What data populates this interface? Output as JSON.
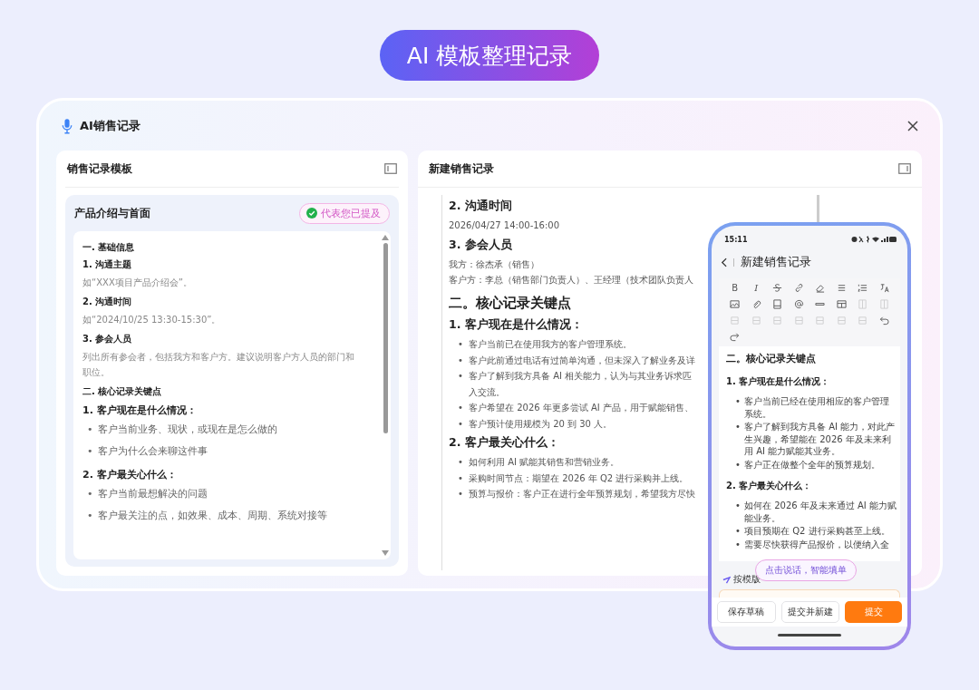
{
  "banner": {
    "title": "AI 模板整理记录"
  },
  "window": {
    "title": "AI销售记录"
  },
  "template_panel": {
    "title": "销售记录模板",
    "card": {
      "title": "产品介绍与首面",
      "badge": "代表您已提及",
      "blocks": [
        {
          "kind": "h3",
          "text": "一. 基础信息"
        },
        {
          "kind": "h3",
          "text": "1. 沟通主题"
        },
        {
          "kind": "hint",
          "lines": [
            "如“XXX项目产品介绍会”。"
          ]
        },
        {
          "kind": "h3",
          "text": "2. 沟通时间"
        },
        {
          "kind": "hint",
          "lines": [
            "如“2024/10/25 13:30-15:30”。"
          ]
        },
        {
          "kind": "h3",
          "text": "3. 参会人员"
        },
        {
          "kind": "hint",
          "lines": [
            "列出所有参会者，包括我方和客户方。建议说明客户方人员的部门和",
            "职位。"
          ]
        },
        {
          "kind": "h3",
          "text": "二. 核心记录关键点"
        },
        {
          "kind": "h2",
          "text": "1. 客户现在是什么情况："
        },
        {
          "kind": "bullets",
          "marker": "•",
          "items": [
            [
              "客户当前业务、现状，或现在是怎么做的"
            ],
            [
              "客户为什么会来聊这件事"
            ]
          ]
        },
        {
          "kind": "h2",
          "text": "2. 客户最关心什么："
        },
        {
          "kind": "bullets",
          "marker": "•",
          "items": [
            [
              "客户当前最想解决的问题"
            ],
            [
              "客户最关注的点，如效果、成本、周期、系统对接等"
            ]
          ]
        }
      ]
    }
  },
  "record_panel": {
    "title": "新建销售记录",
    "blocks": [
      {
        "kind": "h2",
        "text": "2. 沟通时间"
      },
      {
        "kind": "text",
        "lines": [
          "2026/04/27 14:00-16:00"
        ]
      },
      {
        "kind": "h2",
        "text": "3. 参会人员"
      },
      {
        "kind": "text",
        "lines": [
          "我方：徐杰承（销售）",
          "客户方：李总（销售部门负责人）、王经理（技术团队负责人"
        ]
      },
      {
        "kind": "h1",
        "text": "二。核心记录关键点"
      },
      {
        "kind": "h2",
        "text": "1. 客户现在是什么情况："
      },
      {
        "kind": "bullets",
        "marker": "•",
        "items": [
          [
            "客户当前已在使用我方的客户管理系统。"
          ],
          [
            "客户此前通过电话有过简单沟通，但未深入了解业务及详"
          ],
          [
            "客户了解到我方具备 AI 相关能力，认为与其业务诉求匹",
            "入交流。"
          ],
          [
            "客户希望在 2026 年更多尝试 AI 产品，用于赋能销售、"
          ],
          [
            "客户预计使用规模为 20 到 30 人。"
          ]
        ]
      },
      {
        "kind": "h2",
        "text": "2. 客户最关心什么："
      },
      {
        "kind": "bullets",
        "marker": "•",
        "items": [
          [
            "如何利用 AI 赋能其销售和营销业务。"
          ],
          [
            "采购时间节点：期望在 2026 年 Q2 进行采购并上线。"
          ],
          [
            "预算与报价：客户正在进行全年预算规划，希望我方尽快"
          ]
        ]
      }
    ]
  },
  "phone": {
    "time": "15:11",
    "title": "新建销售记录",
    "toolbar": [
      {
        "kind": "bold",
        "label": "B",
        "disabled": false
      },
      {
        "kind": "italic",
        "label": "I",
        "disabled": false
      },
      {
        "kind": "strike",
        "disabled": false
      },
      {
        "kind": "link",
        "disabled": false
      },
      {
        "kind": "eraser",
        "disabled": false
      },
      {
        "kind": "bullets",
        "disabled": false
      },
      {
        "kind": "numbers",
        "disabled": false
      },
      {
        "kind": "translate",
        "disabled": false
      },
      {
        "kind": "image",
        "disabled": false
      },
      {
        "kind": "clip",
        "disabled": false
      },
      {
        "kind": "card",
        "disabled": false
      },
      {
        "kind": "at",
        "disabled": false
      },
      {
        "kind": "tag",
        "disabled": false
      },
      {
        "kind": "table",
        "disabled": false
      },
      {
        "kind": "column",
        "disabled": true
      },
      {
        "kind": "column",
        "disabled": true
      },
      {
        "kind": "block",
        "disabled": true
      },
      {
        "kind": "block",
        "disabled": true
      },
      {
        "kind": "block",
        "disabled": true
      },
      {
        "kind": "block",
        "disabled": true
      },
      {
        "kind": "block",
        "disabled": true
      },
      {
        "kind": "block",
        "disabled": true
      },
      {
        "kind": "block",
        "disabled": true
      },
      {
        "kind": "undo",
        "disabled": false
      },
      {
        "kind": "redo",
        "disabled": false
      }
    ],
    "blocks": [
      {
        "kind": "h1",
        "text": "二。核心记录关键点"
      },
      {
        "kind": "h2",
        "text": "1. 客户现在是什么情况："
      },
      {
        "kind": "bullets",
        "marker": "•",
        "items": [
          [
            "客户当前已经在使用相应的客户管理",
            "系统。"
          ],
          [
            "客户了解到我方具备 AI 能力，对此产",
            "生兴趣，希望能在 2026 年及未来利",
            "用 AI 能力赋能其业务。"
          ],
          [
            "客户正在做整个全年的预算规划。"
          ]
        ]
      },
      {
        "kind": "h2",
        "text": "2. 客户最关心什么："
      },
      {
        "kind": "bullets",
        "marker": "•",
        "items": [
          [
            "如何在 2026 年及未来通过 AI 能力赋",
            "能业务。"
          ],
          [
            "项目预期在 Q2 进行采购甚至上线。"
          ],
          [
            "需要尽快获得产品报价，以便纳入全"
          ]
        ]
      }
    ],
    "template_hint": "按模版",
    "voice_button": "点击说话，智能填单",
    "buttons": [
      {
        "label": "保存草稿",
        "kind": "secondary"
      },
      {
        "label": "提交并新建",
        "kind": "secondary"
      },
      {
        "label": "提交",
        "kind": "primary"
      }
    ]
  }
}
